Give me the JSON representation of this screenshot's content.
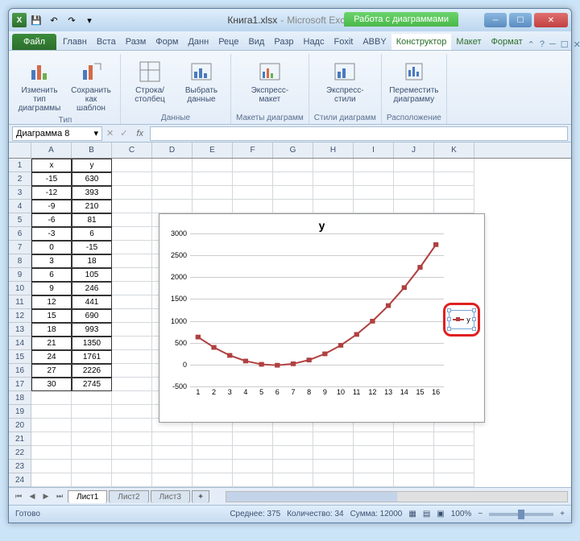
{
  "window": {
    "filename": "Книга1.xlsx",
    "app": "Microsoft Excel",
    "context_title": "Работа с диаграммами"
  },
  "qat": {
    "save": "💾",
    "undo": "↶",
    "redo": "↷"
  },
  "tabs": {
    "file": "Файл",
    "items": [
      "Главн",
      "Вста",
      "Разм",
      "Форм",
      "Данн",
      "Реце",
      "Вид",
      "Разр",
      "Надс",
      "Foxit",
      "ABBY"
    ],
    "context": [
      "Конструктор",
      "Макет",
      "Формат"
    ]
  },
  "ribbon": {
    "groups": [
      {
        "label": "Тип",
        "buttons": [
          "Изменить тип диаграммы",
          "Сохранить как шаблон"
        ]
      },
      {
        "label": "Данные",
        "buttons": [
          "Строка/столбец",
          "Выбрать данные"
        ]
      },
      {
        "label": "Макеты диаграмм",
        "buttons": [
          "Экспресс-макет"
        ]
      },
      {
        "label": "Стили диаграмм",
        "buttons": [
          "Экспресс-стили"
        ]
      },
      {
        "label": "Расположение",
        "buttons": [
          "Переместить диаграмму"
        ]
      }
    ]
  },
  "namebox": "Диаграмма 8",
  "fx": "fx",
  "columns": [
    "A",
    "B",
    "C",
    "D",
    "E",
    "F",
    "G",
    "H",
    "I",
    "J",
    "K"
  ],
  "rows_visible": 24,
  "data_table": {
    "headers": [
      "x",
      "y"
    ],
    "rows": [
      [
        -15,
        630
      ],
      [
        -12,
        393
      ],
      [
        -9,
        210
      ],
      [
        -6,
        81
      ],
      [
        -3,
        6
      ],
      [
        0,
        -15
      ],
      [
        3,
        18
      ],
      [
        6,
        105
      ],
      [
        9,
        246
      ],
      [
        12,
        441
      ],
      [
        15,
        690
      ],
      [
        18,
        993
      ],
      [
        21,
        1350
      ],
      [
        24,
        1761
      ],
      [
        27,
        2226
      ],
      [
        30,
        2745
      ]
    ]
  },
  "chart_data": {
    "type": "line",
    "title": "y",
    "xlabel": "",
    "ylabel": "",
    "categories": [
      1,
      2,
      3,
      4,
      5,
      6,
      7,
      8,
      9,
      10,
      11,
      12,
      13,
      14,
      15,
      16
    ],
    "series": [
      {
        "name": "y",
        "values": [
          630,
          393,
          210,
          81,
          6,
          -15,
          18,
          105,
          246,
          441,
          690,
          993,
          1350,
          1761,
          2226,
          2745
        ],
        "color": "#b04040"
      }
    ],
    "ylim": [
      -500,
      3000
    ],
    "yticks": [
      -500,
      0,
      500,
      1000,
      1500,
      2000,
      2500,
      3000
    ],
    "legend_position": "right",
    "legend_selected": true
  },
  "sheets": {
    "active": "Лист1",
    "others": [
      "Лист2",
      "Лист3"
    ]
  },
  "status": {
    "ready": "Готово",
    "avg_label": "Среднее:",
    "avg": "375",
    "count_label": "Количество:",
    "count": "34",
    "sum_label": "Сумма:",
    "sum": "12000",
    "zoom": "100%"
  }
}
